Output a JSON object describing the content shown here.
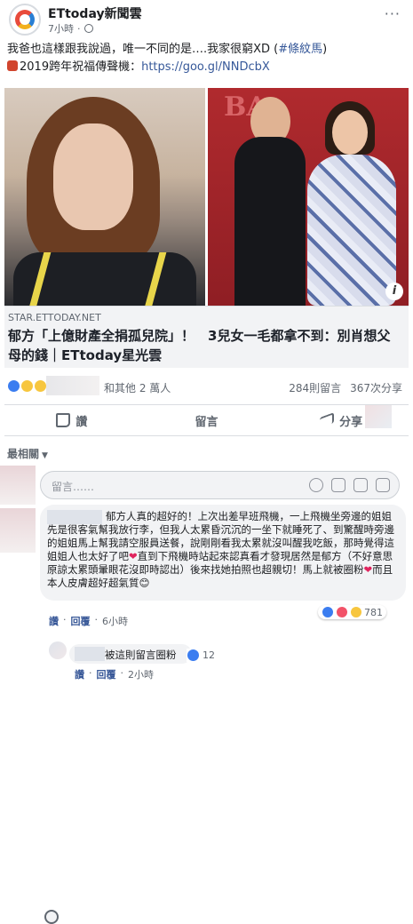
{
  "header": {
    "page_name": "ETtoday新聞雲",
    "time": "7小時",
    "separator": "·",
    "more": "···"
  },
  "post": {
    "text_main": "我爸也這樣跟我說過，唯一不同的是….我家很窮XD (",
    "hashtag": "#條紋馬",
    "text_close": ")",
    "promo_text": "2019跨年祝福傳聲機：",
    "promo_link": "https://goo.gl/NNDcbX"
  },
  "photo": {
    "sign_text": "BA",
    "info": "i"
  },
  "link_card": {
    "domain": "STAR.ETTODAY.NET",
    "title": "郁方「上億財產全捐孤兒院」！　3兒女一毛都拿不到：別肖想父母的錢｜ETtoday星光雲"
  },
  "reactions": {
    "text": "和其他 2 萬人",
    "comments": "284則留言",
    "shares": "367次分享"
  },
  "actions": {
    "like": "讚",
    "comment": "留言",
    "share": "分享"
  },
  "comments_section": {
    "sort_label": "最相關",
    "composer_placeholder": "留言……"
  },
  "comment": {
    "body_1": "郁方人真的超好的！上次出差早班飛機，一上飛機坐旁邊的姐姐先是很客氣幫我放行李，但我人太累昏沉沉的一坐下就睡死了、到驚醒時旁邊的姐姐馬上幫我請空服員送餐，說剛剛看我太累就沒叫醒我吃飯，那時覺得這姐姐人也太好了吧",
    "body_2": "直到下飛機時站起來認真看才發現居然是郁方（不好意思原諒太累頭暈眼花沒即時認出）後來找她拍照也超親切！馬上就被圈粉",
    "body_3": "而且本人皮膚超好超氣質",
    "reaction_count": "781",
    "like": "讚",
    "reply": "回覆",
    "time": "6小時",
    "dot": "·"
  },
  "reply": {
    "text": "被這則留言圈粉",
    "reaction_count": "12",
    "like": "讚",
    "reply": "回覆",
    "time": "2小時",
    "dot": "·"
  }
}
